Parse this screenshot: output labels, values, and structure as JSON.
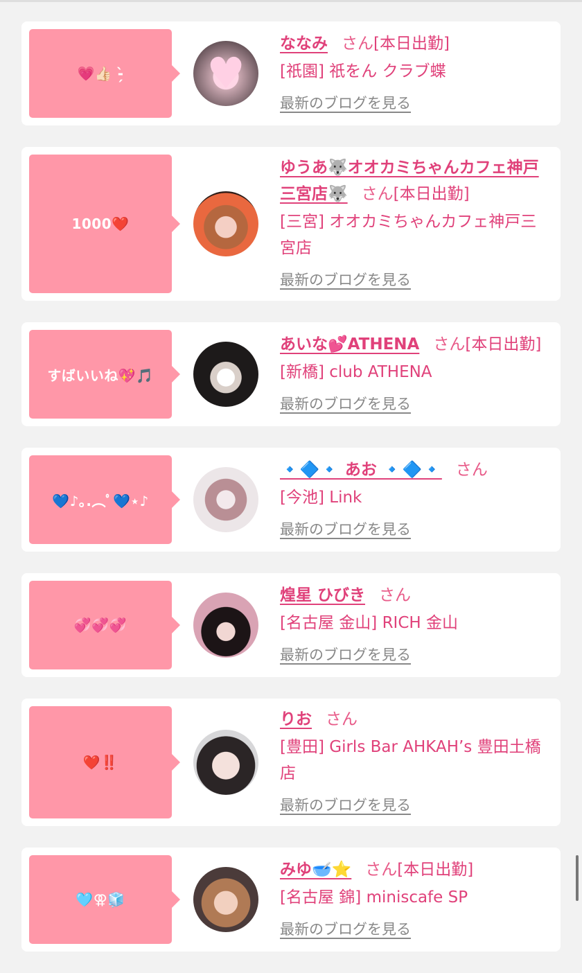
{
  "cards": [
    {
      "comment": "💗👍🏻 ‑̗̀",
      "name": "ななみ",
      "suffix": "さん",
      "status": "[本日出勤]",
      "shop": "[祇園] 祇をん クラブ蝶",
      "blog": "最新のブログを見る",
      "avatar_icon": "heart-photo-icon"
    },
    {
      "comment": "1000❤️",
      "name": "ゆうあ🐺オオカミちゃんカフェ神戸三宮店🐺",
      "suffix": "さん",
      "status": "[本日出勤]",
      "shop": "[三宮] オオカミちゃんカフェ神戸三宮店",
      "blog": "最新のブログを見る",
      "avatar_icon": "profile-photo-icon"
    },
    {
      "comment": "すばいいね💖🎵",
      "name": "あいな💕ATHENA",
      "suffix": "さん",
      "status": "[本日出勤]",
      "shop": "[新橋] club ATHENA",
      "blog": "最新のブログを見る",
      "avatar_icon": "profile-photo-icon"
    },
    {
      "comment": "💙♪｡.︵ﾟ💙⋆♪",
      "name": "🔹🔷🔹 あお 🔹🔷🔹",
      "suffix": "さん",
      "status": "",
      "shop": "[今池] Link",
      "blog": "最新のブログを見る",
      "avatar_icon": "illustration-photo-icon"
    },
    {
      "comment": "💞💞💞",
      "name": "煌星 ひびき",
      "suffix": "さん",
      "status": "",
      "shop": "[名古屋 金山] RICH 金山",
      "blog": "最新のブログを見る",
      "avatar_icon": "profile-photo-icon"
    },
    {
      "comment": "❤️‼️",
      "name": "りお",
      "suffix": "さん",
      "status": "",
      "shop": "[豊田] Girls Bar AHKAH’s 豊田土橋店",
      "blog": "最新のブログを見る",
      "avatar_icon": "profile-photo-icon"
    },
    {
      "comment": "🩵⚢🧊",
      "name": "みゆ🥣⭐",
      "suffix": "さん",
      "status": "[本日出勤]",
      "shop": "[名古屋 錦] miniscafe SP",
      "blog": "最新のブログを見る",
      "avatar_icon": "profile-photo-icon"
    }
  ],
  "colors": {
    "accent": "#e0417a",
    "bubble": "#ff97a8",
    "link_gray": "#888888",
    "background": "#f2f2f2"
  }
}
